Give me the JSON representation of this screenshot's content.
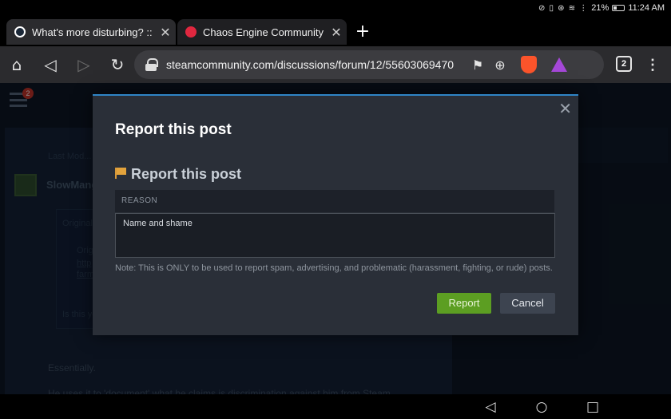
{
  "status_bar": {
    "icons": "⊘ ▯ ⊛ ≋ ⋮",
    "battery": "21%",
    "time": "11:24 AM"
  },
  "tabs": [
    {
      "title": "What's more disturbing? :: Off",
      "favicon": "steam-favicon",
      "active": true
    },
    {
      "title": "Chaos Engine Community",
      "favicon": "chaos-engine-favicon",
      "active": false
    }
  ],
  "toolbar": {
    "url": "steamcommunity.com/discussions/forum/12/55603069470",
    "tab_count": "2"
  },
  "page": {
    "notification_count": "2",
    "user": "SlowMang",
    "lines": {
      "fragment_a": "Last Mod...",
      "originally_1": "Originall",
      "originally_2": "Origi",
      "link_1": "http",
      "link_2": "farm",
      "is_this": "Is this yo",
      "essentially": "Essentially.",
      "he_uses": "He uses it to 'document' what he claims is discrimination against him from Steam"
    }
  },
  "modal": {
    "title": "Report this post",
    "section_title": "Report this post",
    "reason_label": "REASON",
    "reason_value": "Name and shame",
    "note": "Note: This is ONLY to be used to report spam, advertising, and problematic (harassment, fighting, or rude) posts.",
    "report_label": "Report",
    "cancel_label": "Cancel",
    "close_glyph": "✕"
  },
  "colors": {
    "accent_blue": "#2f85c6",
    "report_green": "#5c9e22",
    "flag_orange": "#e3a33c"
  }
}
